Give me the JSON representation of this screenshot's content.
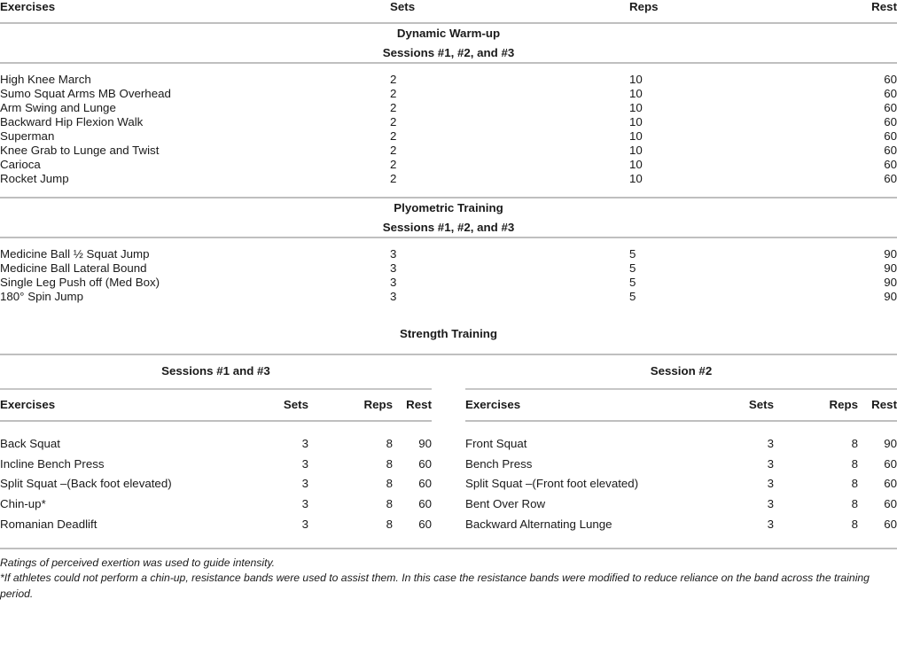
{
  "table": {
    "columns": {
      "exercises": "Exercises",
      "sets": "Sets",
      "reps": "Reps",
      "rest": "Rest"
    },
    "sections": [
      {
        "title": "Dynamic Warm-up",
        "subtitle": "Sessions #1, #2, and #3",
        "rows": [
          {
            "exercise": "High Knee March",
            "sets": "2",
            "reps": "10",
            "rest": "60"
          },
          {
            "exercise": "Sumo Squat Arms MB Overhead",
            "sets": "2",
            "reps": "10",
            "rest": "60"
          },
          {
            "exercise": "Arm Swing and Lunge",
            "sets": "2",
            "reps": "10",
            "rest": "60"
          },
          {
            "exercise": "Backward Hip Flexion Walk",
            "sets": "2",
            "reps": "10",
            "rest": "60"
          },
          {
            "exercise": "Superman",
            "sets": "2",
            "reps": "10",
            "rest": "60"
          },
          {
            "exercise": "Knee Grab to Lunge and Twist",
            "sets": "2",
            "reps": "10",
            "rest": "60"
          },
          {
            "exercise": "Carioca",
            "sets": "2",
            "reps": "10",
            "rest": "60"
          },
          {
            "exercise": "Rocket Jump",
            "sets": "2",
            "reps": "10",
            "rest": "60"
          }
        ]
      },
      {
        "title": "Plyometric Training",
        "subtitle": "Sessions #1, #2, and #3",
        "rows": [
          {
            "exercise": "Medicine Ball ½ Squat Jump",
            "sets": "3",
            "reps": "5",
            "rest": "90"
          },
          {
            "exercise": "Medicine Ball Lateral Bound",
            "sets": "3",
            "reps": "5",
            "rest": "90"
          },
          {
            "exercise": "Single Leg Push off (Med Box)",
            "sets": "3",
            "reps": "5",
            "rest": "90"
          },
          {
            "exercise": "180° Spin Jump",
            "sets": "3",
            "reps": "5",
            "rest": "90"
          }
        ]
      }
    ],
    "strength": {
      "title": "Strength Training",
      "left": {
        "subtitle": "Sessions #1 and #3",
        "columns": {
          "exercises": "Exercises",
          "sets": "Sets",
          "reps": "Reps",
          "rest": "Rest"
        },
        "rows": [
          {
            "exercise": "Back Squat",
            "sets": "3",
            "reps": "8",
            "rest": "90"
          },
          {
            "exercise": "Incline Bench Press",
            "sets": "3",
            "reps": "8",
            "rest": "60"
          },
          {
            "exercise": "Split Squat –(Back foot elevated)",
            "sets": "3",
            "reps": "8",
            "rest": "60"
          },
          {
            "exercise": "Chin-up*",
            "sets": "3",
            "reps": "8",
            "rest": "60"
          },
          {
            "exercise": "Romanian Deadlift",
            "sets": "3",
            "reps": "8",
            "rest": "60"
          }
        ]
      },
      "right": {
        "subtitle": "Session #2",
        "columns": {
          "exercises": "Exercises",
          "sets": "Sets",
          "reps": "Reps",
          "rest": "Rest"
        },
        "rows": [
          {
            "exercise": "Front Squat",
            "sets": "3",
            "reps": "8",
            "rest": "90"
          },
          {
            "exercise": "Bench Press",
            "sets": "3",
            "reps": "8",
            "rest": "60"
          },
          {
            "exercise": "Split Squat –(Front foot elevated)",
            "sets": "3",
            "reps": "8",
            "rest": "60"
          },
          {
            "exercise": "Bent Over Row",
            "sets": "3",
            "reps": "8",
            "rest": "60"
          },
          {
            "exercise": "Backward Alternating Lunge",
            "sets": "3",
            "reps": "8",
            "rest": "60"
          }
        ]
      }
    },
    "footnotes": [
      "Ratings of perceived exertion was used to guide intensity.",
      "*If athletes could not perform a chin-up, resistance bands were used to assist them. In this case the resistance bands were modified to reduce reliance on the band across the training period."
    ]
  }
}
